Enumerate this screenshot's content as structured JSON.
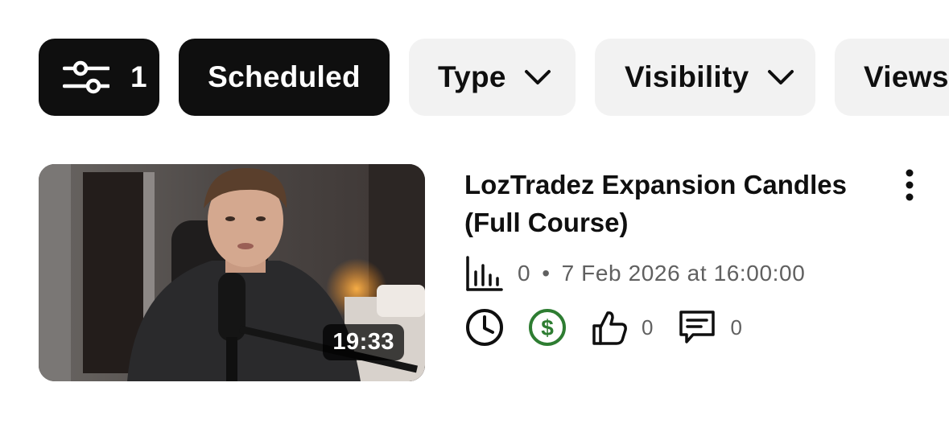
{
  "filters": {
    "filter_count": "1",
    "chips": [
      {
        "label": "Scheduled",
        "selected": true
      },
      {
        "label": "Type",
        "selected": false
      },
      {
        "label": "Visibility",
        "selected": false
      },
      {
        "label": "Views",
        "selected": false
      }
    ]
  },
  "video": {
    "title": "LozTradez Expansion Candles (Full Course)",
    "duration": "19:33",
    "views": "0",
    "separator": "•",
    "scheduled_time": "7 Feb 2026 at 16:00:00",
    "likes": "0",
    "comments": "0"
  },
  "icons": {
    "filter": "sliders-icon",
    "chevron": "chevron-down-icon",
    "more": "more-vertical-icon",
    "analytics": "bar-chart-icon",
    "schedule": "clock-icon",
    "monetization": "dollar-circle-icon",
    "likes": "thumbs-up-icon",
    "comments": "comment-icon"
  },
  "colors": {
    "chip_selected_bg": "#0f0f0f",
    "chip_bg": "#f2f2f2",
    "monetization_green": "#2e7d32",
    "secondary_text": "#606060"
  }
}
